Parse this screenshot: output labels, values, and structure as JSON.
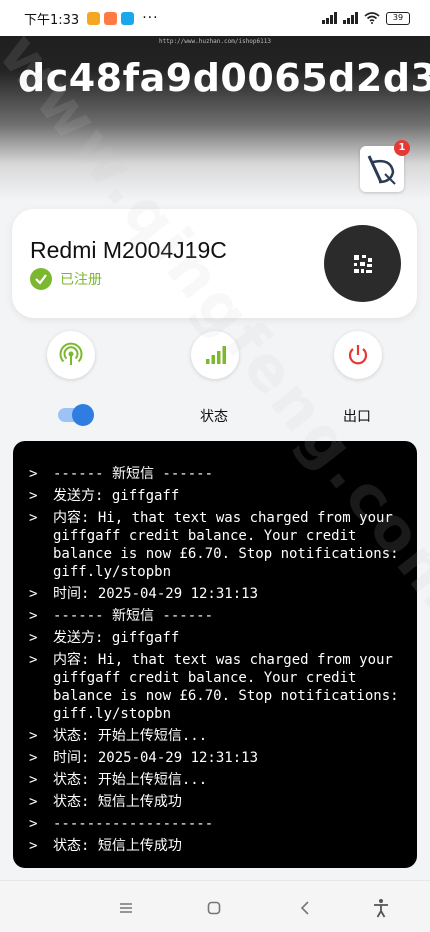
{
  "status_bar": {
    "time": "下午1:33",
    "dots": "···",
    "battery": "39",
    "app_colors": [
      "#f5a623",
      "#ff7a45",
      "#1aa7ec"
    ]
  },
  "header": {
    "url": "http://www.huzhan.com/ishop6113",
    "device_id": "dc48fa9d0065d2d3",
    "notification_badge": "1"
  },
  "device_card": {
    "model": "Redmi M2004J19C",
    "registration_status": "已注册"
  },
  "actions": {
    "toggle_on": true,
    "status_label": "状态",
    "exit_label": "出口"
  },
  "console": {
    "prompt": ">",
    "lines": [
      "------ 新短信 ------",
      "发送方: giffgaff",
      "内容: Hi, that text was charged from your giffgaff credit balance. Your credit balance is now £6.70. Stop notifications: giff.ly/stopbn",
      "时间: 2025-04-29 12:31:13",
      "------ 新短信 ------",
      "发送方: giffgaff",
      "内容: Hi, that text was charged from your giffgaff credit balance. Your credit balance is now £6.70. Stop notifications: giff.ly/stopbn",
      "状态: 开始上传短信...",
      "时间: 2025-04-29 12:31:13",
      "状态: 开始上传短信...",
      "状态: 短信上传成功",
      "-------------------",
      "状态: 短信上传成功"
    ]
  },
  "watermark": "www.qingfeng.com",
  "colors": {
    "accent_green": "#7cb82f",
    "toggle_blue": "#2f7de1",
    "power_red": "#e53935",
    "console_bg": "#000000"
  },
  "nav_icons": [
    "menu-icon",
    "home-icon",
    "back-icon",
    "accessibility-icon"
  ]
}
